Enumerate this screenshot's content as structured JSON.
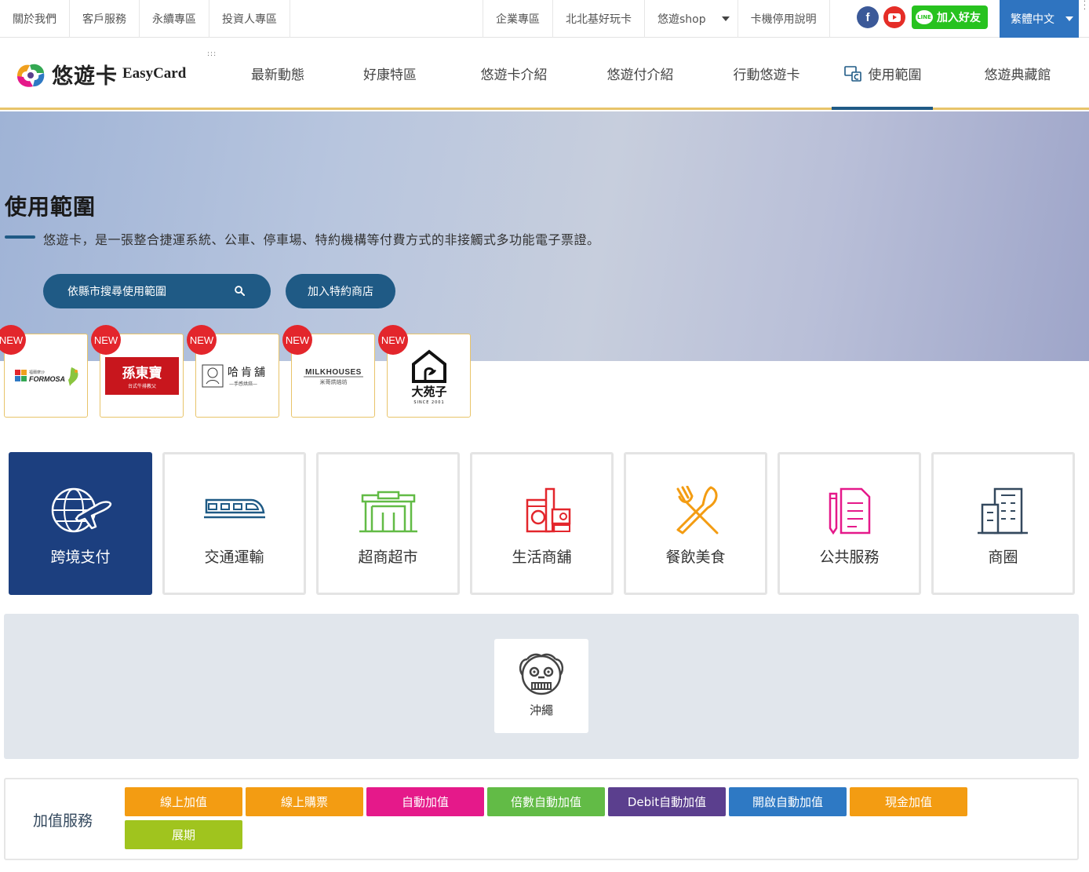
{
  "topbar": {
    "left_links": [
      "關於我們",
      "客戶服務",
      "永續專區",
      "投資人專區"
    ],
    "right_links": [
      "企業專區",
      "北北基好玩卡",
      "悠遊shop",
      "卡機停用說明"
    ],
    "line_label": "加入好友",
    "line_bubble": "LINE",
    "facebook_glyph": "f",
    "language": "繁體中文"
  },
  "nav": {
    "logo_text": "悠遊卡",
    "logo_en": "EasyCard",
    "menu_dots": ":::",
    "items": [
      "最新動態",
      "好康特區",
      "悠遊卡介紹",
      "悠遊付介紹",
      "行動悠遊卡",
      "使用範圍",
      "悠遊典藏館"
    ],
    "active": "使用範圍"
  },
  "hero": {
    "title": "使用範圍",
    "subtitle": "悠遊卡，是一張整合捷運系統、公車、停車場、特約機構等付費方式的非接觸式多功能電子票證。",
    "search_label": "依縣市搜尋使用範圍",
    "join_label": "加入特約商店"
  },
  "new_merchants": {
    "badge": "NEW",
    "items": [
      {
        "name": "FORMOSA",
        "sub": "福爾摩沙"
      },
      {
        "name": "孫東寶",
        "sub": "台式牛排教父"
      },
      {
        "name": "哈肯舖",
        "sub": "—手感烘焙—"
      },
      {
        "name": "MILKHOUSES",
        "sub": "米哥烘焙坊"
      },
      {
        "name": "大苑子",
        "sub": "SINCE 2001"
      }
    ]
  },
  "categories": [
    "跨境支付",
    "交通運輸",
    "超商超市",
    "生活商舖",
    "餐飲美食",
    "公共服務",
    "商圈"
  ],
  "active_category": "跨境支付",
  "region": {
    "label": "沖繩"
  },
  "topup": {
    "title": "加值服務",
    "buttons": [
      {
        "label": "線上加值",
        "color": "#f39c12"
      },
      {
        "label": "線上購票",
        "color": "#f39c12"
      },
      {
        "label": "自動加值",
        "color": "#e5198a"
      },
      {
        "label": "倍數自動加值",
        "color": "#62bb46"
      },
      {
        "label": "Debit自動加值",
        "color": "#5b3f8e"
      },
      {
        "label": "開啟自動加值",
        "color": "#2e79c4"
      },
      {
        "label": "現金加值",
        "color": "#f39c12"
      },
      {
        "label": "展期",
        "color": "#a0c41e"
      }
    ]
  },
  "colors": {
    "brand_blue": "#1f5a85",
    "active_cat": "#1c3f7f",
    "accent_gold": "#e8c46a",
    "badge_red": "#e3262c"
  }
}
